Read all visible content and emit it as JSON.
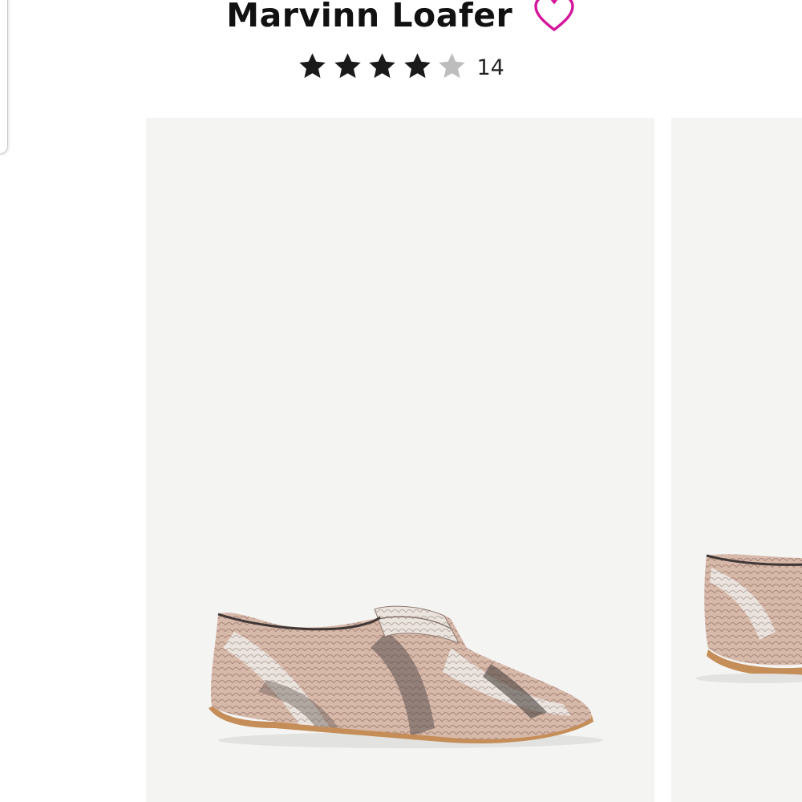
{
  "product": {
    "name": "Marvinn Loafer",
    "rating": 4,
    "rating_max": 5,
    "review_count": "14"
  },
  "icons": {
    "wishlist": "heart-outline-icon",
    "star_filled": "star-filled-icon",
    "star_empty": "star-empty-icon"
  },
  "colors": {
    "heart": "#d4169a",
    "star_filled": "#1a1a1a",
    "star_empty": "#bdbdbd",
    "gallery_background": "#f4f4f3"
  },
  "gallery": {
    "images": [
      {
        "subject": "snake-print loafer, side angle"
      },
      {
        "subject": "snake-print loafer, alternate angle (partially visible)"
      }
    ]
  }
}
